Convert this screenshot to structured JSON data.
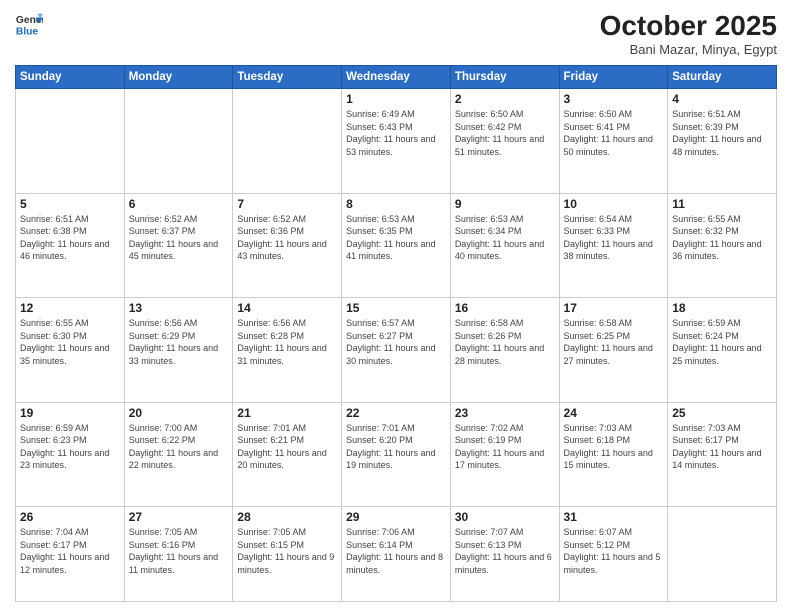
{
  "header": {
    "logo_general": "General",
    "logo_blue": "Blue",
    "month_title": "October 2025",
    "subtitle": "Bani Mazar, Minya, Egypt"
  },
  "weekdays": [
    "Sunday",
    "Monday",
    "Tuesday",
    "Wednesday",
    "Thursday",
    "Friday",
    "Saturday"
  ],
  "weeks": [
    [
      {
        "day": "",
        "sunrise": "",
        "sunset": "",
        "daylight": ""
      },
      {
        "day": "",
        "sunrise": "",
        "sunset": "",
        "daylight": ""
      },
      {
        "day": "",
        "sunrise": "",
        "sunset": "",
        "daylight": ""
      },
      {
        "day": "1",
        "sunrise": "Sunrise: 6:49 AM",
        "sunset": "Sunset: 6:43 PM",
        "daylight": "Daylight: 11 hours and 53 minutes."
      },
      {
        "day": "2",
        "sunrise": "Sunrise: 6:50 AM",
        "sunset": "Sunset: 6:42 PM",
        "daylight": "Daylight: 11 hours and 51 minutes."
      },
      {
        "day": "3",
        "sunrise": "Sunrise: 6:50 AM",
        "sunset": "Sunset: 6:41 PM",
        "daylight": "Daylight: 11 hours and 50 minutes."
      },
      {
        "day": "4",
        "sunrise": "Sunrise: 6:51 AM",
        "sunset": "Sunset: 6:39 PM",
        "daylight": "Daylight: 11 hours and 48 minutes."
      }
    ],
    [
      {
        "day": "5",
        "sunrise": "Sunrise: 6:51 AM",
        "sunset": "Sunset: 6:38 PM",
        "daylight": "Daylight: 11 hours and 46 minutes."
      },
      {
        "day": "6",
        "sunrise": "Sunrise: 6:52 AM",
        "sunset": "Sunset: 6:37 PM",
        "daylight": "Daylight: 11 hours and 45 minutes."
      },
      {
        "day": "7",
        "sunrise": "Sunrise: 6:52 AM",
        "sunset": "Sunset: 6:36 PM",
        "daylight": "Daylight: 11 hours and 43 minutes."
      },
      {
        "day": "8",
        "sunrise": "Sunrise: 6:53 AM",
        "sunset": "Sunset: 6:35 PM",
        "daylight": "Daylight: 11 hours and 41 minutes."
      },
      {
        "day": "9",
        "sunrise": "Sunrise: 6:53 AM",
        "sunset": "Sunset: 6:34 PM",
        "daylight": "Daylight: 11 hours and 40 minutes."
      },
      {
        "day": "10",
        "sunrise": "Sunrise: 6:54 AM",
        "sunset": "Sunset: 6:33 PM",
        "daylight": "Daylight: 11 hours and 38 minutes."
      },
      {
        "day": "11",
        "sunrise": "Sunrise: 6:55 AM",
        "sunset": "Sunset: 6:32 PM",
        "daylight": "Daylight: 11 hours and 36 minutes."
      }
    ],
    [
      {
        "day": "12",
        "sunrise": "Sunrise: 6:55 AM",
        "sunset": "Sunset: 6:30 PM",
        "daylight": "Daylight: 11 hours and 35 minutes."
      },
      {
        "day": "13",
        "sunrise": "Sunrise: 6:56 AM",
        "sunset": "Sunset: 6:29 PM",
        "daylight": "Daylight: 11 hours and 33 minutes."
      },
      {
        "day": "14",
        "sunrise": "Sunrise: 6:56 AM",
        "sunset": "Sunset: 6:28 PM",
        "daylight": "Daylight: 11 hours and 31 minutes."
      },
      {
        "day": "15",
        "sunrise": "Sunrise: 6:57 AM",
        "sunset": "Sunset: 6:27 PM",
        "daylight": "Daylight: 11 hours and 30 minutes."
      },
      {
        "day": "16",
        "sunrise": "Sunrise: 6:58 AM",
        "sunset": "Sunset: 6:26 PM",
        "daylight": "Daylight: 11 hours and 28 minutes."
      },
      {
        "day": "17",
        "sunrise": "Sunrise: 6:58 AM",
        "sunset": "Sunset: 6:25 PM",
        "daylight": "Daylight: 11 hours and 27 minutes."
      },
      {
        "day": "18",
        "sunrise": "Sunrise: 6:59 AM",
        "sunset": "Sunset: 6:24 PM",
        "daylight": "Daylight: 11 hours and 25 minutes."
      }
    ],
    [
      {
        "day": "19",
        "sunrise": "Sunrise: 6:59 AM",
        "sunset": "Sunset: 6:23 PM",
        "daylight": "Daylight: 11 hours and 23 minutes."
      },
      {
        "day": "20",
        "sunrise": "Sunrise: 7:00 AM",
        "sunset": "Sunset: 6:22 PM",
        "daylight": "Daylight: 11 hours and 22 minutes."
      },
      {
        "day": "21",
        "sunrise": "Sunrise: 7:01 AM",
        "sunset": "Sunset: 6:21 PM",
        "daylight": "Daylight: 11 hours and 20 minutes."
      },
      {
        "day": "22",
        "sunrise": "Sunrise: 7:01 AM",
        "sunset": "Sunset: 6:20 PM",
        "daylight": "Daylight: 11 hours and 19 minutes."
      },
      {
        "day": "23",
        "sunrise": "Sunrise: 7:02 AM",
        "sunset": "Sunset: 6:19 PM",
        "daylight": "Daylight: 11 hours and 17 minutes."
      },
      {
        "day": "24",
        "sunrise": "Sunrise: 7:03 AM",
        "sunset": "Sunset: 6:18 PM",
        "daylight": "Daylight: 11 hours and 15 minutes."
      },
      {
        "day": "25",
        "sunrise": "Sunrise: 7:03 AM",
        "sunset": "Sunset: 6:17 PM",
        "daylight": "Daylight: 11 hours and 14 minutes."
      }
    ],
    [
      {
        "day": "26",
        "sunrise": "Sunrise: 7:04 AM",
        "sunset": "Sunset: 6:17 PM",
        "daylight": "Daylight: 11 hours and 12 minutes."
      },
      {
        "day": "27",
        "sunrise": "Sunrise: 7:05 AM",
        "sunset": "Sunset: 6:16 PM",
        "daylight": "Daylight: 11 hours and 11 minutes."
      },
      {
        "day": "28",
        "sunrise": "Sunrise: 7:05 AM",
        "sunset": "Sunset: 6:15 PM",
        "daylight": "Daylight: 11 hours and 9 minutes."
      },
      {
        "day": "29",
        "sunrise": "Sunrise: 7:06 AM",
        "sunset": "Sunset: 6:14 PM",
        "daylight": "Daylight: 11 hours and 8 minutes."
      },
      {
        "day": "30",
        "sunrise": "Sunrise: 7:07 AM",
        "sunset": "Sunset: 6:13 PM",
        "daylight": "Daylight: 11 hours and 6 minutes."
      },
      {
        "day": "31",
        "sunrise": "Sunrise: 6:07 AM",
        "sunset": "Sunset: 5:12 PM",
        "daylight": "Daylight: 11 hours and 5 minutes."
      },
      {
        "day": "",
        "sunrise": "",
        "sunset": "",
        "daylight": ""
      }
    ]
  ]
}
